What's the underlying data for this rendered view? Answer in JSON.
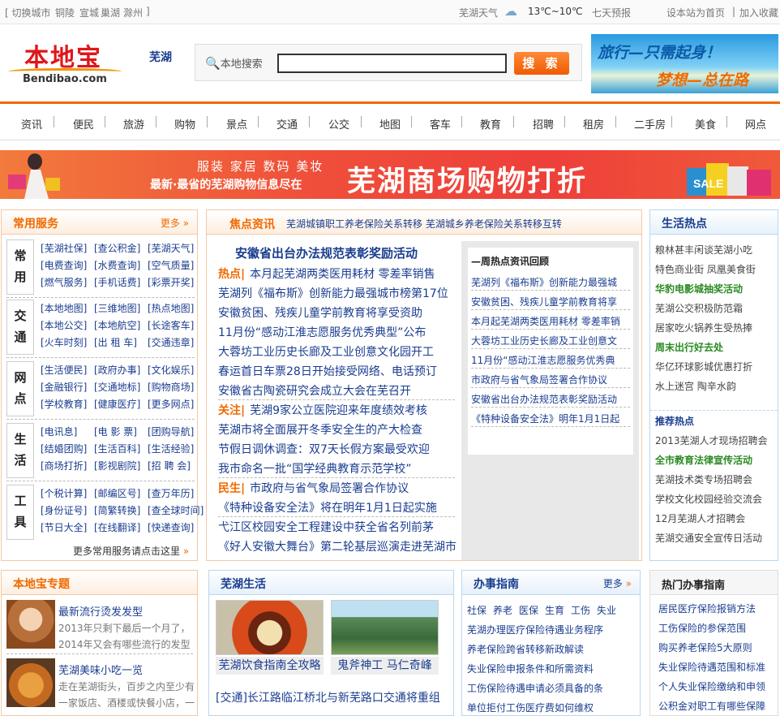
{
  "topbar": {
    "switch_city": "[ 切换城市",
    "cities": [
      "铜陵",
      "宣城",
      "巢湖",
      "滁州"
    ],
    "close": "]",
    "weather_label": "芜湖天气",
    "temp": "13℃~10℃",
    "forecast": "七天预报",
    "set_home": "设本站为首页",
    "divider": "|",
    "add_fav": "加入收藏"
  },
  "header": {
    "logo_cn": "本地宝",
    "logo_en": "Bendibao.com",
    "city": "芜湖",
    "search_label": "本地搜索",
    "search_value": "",
    "search_button": "搜 索",
    "ad_line1": "旅行—只需起身！",
    "ad_line2": "梦想—总在路上！"
  },
  "nav": [
    "资讯",
    "便民",
    "旅游",
    "购物",
    "景点",
    "交通",
    "公交",
    "地图",
    "客车",
    "教育",
    "招聘",
    "租房",
    "二手房",
    "美食",
    "网点"
  ],
  "banner": {
    "cats": "服装  家居  数码  美妆",
    "sub": "最新·最省的芜湖购物信息尽在",
    "big": "芜湖商场购物打折",
    "sale": "SALE"
  },
  "services": {
    "title": "常用服务",
    "more": "更多",
    "groups": [
      {
        "tag": [
          "常",
          "用"
        ],
        "rows": [
          [
            "[芜湖社保]",
            "[查公积金]",
            "[芜湖天气]"
          ],
          [
            "[电费查询]",
            "[水费查询]",
            "[空气质量]"
          ],
          [
            "[燃气服务]",
            "[手机话费]",
            "[彩票开奖]"
          ]
        ]
      },
      {
        "tag": [
          "交",
          "通"
        ],
        "rows": [
          [
            "[本地地图]",
            "[三维地图]",
            "[热点地图]"
          ],
          [
            "[本地公交]",
            "[本地航空]",
            "[长途客车]"
          ],
          [
            "[火车时刻]",
            "[出 租 车]",
            "[交通违章]"
          ]
        ]
      },
      {
        "tag": [
          "网",
          "点"
        ],
        "rows": [
          [
            "[生活便民]",
            "[政府办事]",
            "[文化娱乐]"
          ],
          [
            "[金融银行]",
            "[交通地标]",
            "[购物商场]"
          ],
          [
            "[学校教育]",
            "[健康医疗]",
            "[更多网点]"
          ]
        ]
      },
      {
        "tag": [
          "生",
          "活"
        ],
        "rows": [
          [
            "[电讯息]",
            "[电 影 票]",
            "[团购导航]"
          ],
          [
            "[结婚团购]",
            "[生活百科]",
            "[生活经验]"
          ],
          [
            "[商场打折]",
            "[影视剧院]",
            "[招 聘 会]"
          ]
        ]
      },
      {
        "tag": [
          "工",
          "具"
        ],
        "rows": [
          [
            "[个税计算]",
            "[邮编区号]",
            "[查万年历]"
          ],
          [
            "[身份证号]",
            "[简繁转换]",
            "[查全球时间]"
          ],
          [
            "[节日大全]",
            "[在线翻译]",
            "[快递查询]"
          ]
        ]
      }
    ],
    "more_link": "更多常用服务请点击这里"
  },
  "news": {
    "title": "焦点资讯",
    "ticker": "芜湖城镇职工养老保险关系转移 芜湖城乡养老保险关系转移互转",
    "headline": "安徽省出台办法规范表彰奖励活动",
    "items": [
      {
        "label": "热点|",
        "text": "本月起芜湖两类医用耗材 零差率销售"
      },
      {
        "label": "",
        "text": "芜湖列《福布斯》创新能力最强城市榜第17位"
      },
      {
        "label": "",
        "text": "安徽贫困、残疾儿童学前教育将享受资助"
      },
      {
        "label": "",
        "text": "11月份“感动江淮志愿服务优秀典型”公布"
      },
      {
        "label": "",
        "text": "大蓉坊工业历史长廊及工业创意文化园开工"
      },
      {
        "label": "",
        "text": "春运首日车票28日开始接受网络、电话预订"
      },
      {
        "label": "",
        "text": "安徽省古陶瓷研究会成立大会在芜召开"
      },
      {
        "label": "关注|",
        "text": "芜湖9家公立医院迎来年度绩效考核"
      },
      {
        "label": "",
        "text": "芜湖市将全面展开冬季安全生的产大检查"
      },
      {
        "label": "",
        "text": "节假日调休调查：双7天长假方案最受欢迎"
      },
      {
        "label": "",
        "text": "我市命名一批“国学经典教育示范学校”"
      },
      {
        "label": "民生|",
        "text": "市政府与省气象局签署合作协议"
      },
      {
        "label": "",
        "text": "《特种设备安全法》将在明年1月1日起实施"
      },
      {
        "label": "",
        "text": "弋江区校园安全工程建设中获全省名列前茅"
      },
      {
        "label": "",
        "text": "《好人安徽大舞台》第二轮基层巡演走进芜湖市"
      }
    ],
    "week_title": "—周热点资讯回顾",
    "week": [
      "芜湖列《福布斯》创新能力最强城",
      "安徽贫困、残疾儿童学前教育将享",
      "本月起芜湖两类医用耗材 零差率销",
      "大蓉坊工业历史长廊及工业创意文",
      "11月份“感动江淮志愿服务优秀典",
      "市政府与省气象局签署合作协议",
      "安徽省出台办法规范表彰奖励活动",
      "《特种设备安全法》明年1月1日起"
    ]
  },
  "life_hot": {
    "title": "生活热点",
    "items": [
      {
        "text": "粮林甚丰闲谈芜湖小吃",
        "green": false
      },
      {
        "text": "特色商业街 凤凰美食街",
        "green": false
      },
      {
        "text": "华豹电影城抽奖活动",
        "green": true
      },
      {
        "text": "芜湖公交积极防范霜",
        "green": false
      },
      {
        "text": "居家吃火锅养生受热捧",
        "green": false
      },
      {
        "text": "周末出行好去处",
        "green": true
      },
      {
        "text": "华亿环球影城优惠打折",
        "green": false
      },
      {
        "text": "水上迷宫 陶辛水韵",
        "green": false
      }
    ],
    "rec_title": "推荐热点",
    "rec": [
      {
        "text": "2013芜湖人才现场招聘会",
        "green": false
      },
      {
        "text": "全市教育法律宣传活动",
        "green": true
      },
      {
        "text": "芜湖技术类专场招聘会",
        "green": false
      },
      {
        "text": "学校文化校园经验交流会",
        "green": false
      },
      {
        "text": "12月芜湖人才招聘会",
        "green": false
      },
      {
        "text": "芜湖交通安全宣传日活动",
        "green": false
      }
    ]
  },
  "topics": {
    "title": "本地宝专题",
    "items": [
      {
        "title": "最新流行烫发发型",
        "desc1": "2013年只剩下最后一个月了，",
        "desc2": "2014年又会有哪些流行的发型"
      },
      {
        "title": "芜湖美味小吃一览",
        "desc1": "走在芜湖街头，百步之内至少有",
        "desc2": "一家饭店、酒楼或快餐小店，一"
      }
    ]
  },
  "wuhu_life": {
    "title": "芜湖生活",
    "pics": [
      "芜湖饮食指南全攻略",
      "鬼斧神工 马仁奇峰"
    ],
    "line": "[交通]长江路临江桥北与新芜路口交通将重组"
  },
  "guide": {
    "title": "办事指南",
    "more": "更多",
    "tags": [
      "社保",
      "养老",
      "医保",
      "生育",
      "工伤",
      "失业"
    ],
    "items": [
      "芜湖办理医疗保险待遇业务程序",
      "养老保险跨省转移新政解读",
      "失业保险申报条件和所需资料",
      "工伤保险待遇申请必须具备的条",
      "单位拒付工伤医疗费如何维权"
    ]
  },
  "hot_guide": {
    "title": "热门办事指南",
    "items": [
      "居民医疗保险报销方法",
      "工伤保险的参保范围",
      "购买养老保险5大原则",
      "失业保险待遇范围和标准",
      "个人失业保险缴纳和申领",
      "公积金对职工有哪些保障"
    ]
  },
  "colors": {
    "accent": "#f06a00",
    "link": "#1a3d8f",
    "green": "#2a8a22",
    "red": "#e0161a"
  }
}
